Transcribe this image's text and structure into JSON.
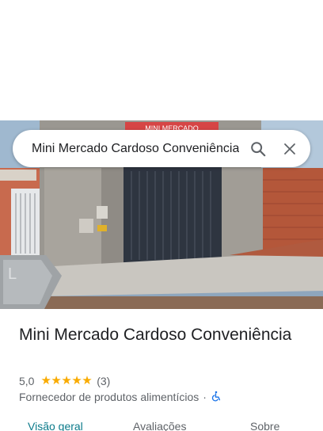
{
  "search": {
    "query": "Mini Mercado Cardoso Conveniência"
  },
  "photo": {
    "sign_text": "MINI MERCADO"
  },
  "place": {
    "name": "Mini Mercado Cardoso Conveniência",
    "rating": "5,0",
    "stars": 5,
    "review_count": "(3)",
    "category": "Fornecedor de produtos alimentícios",
    "separator": "·"
  },
  "tabs": [
    {
      "label": "Visão geral",
      "active": true
    },
    {
      "label": "Avaliações",
      "active": false
    },
    {
      "label": "Sobre",
      "active": false
    }
  ],
  "icons": {
    "search": "search-icon",
    "close": "close-icon",
    "accessibility": "wheelchair-icon",
    "star": "star-icon"
  },
  "colors": {
    "star": "#f9ab00",
    "active_tab": "#0b7a8a",
    "accessibility": "#1a73e8"
  }
}
